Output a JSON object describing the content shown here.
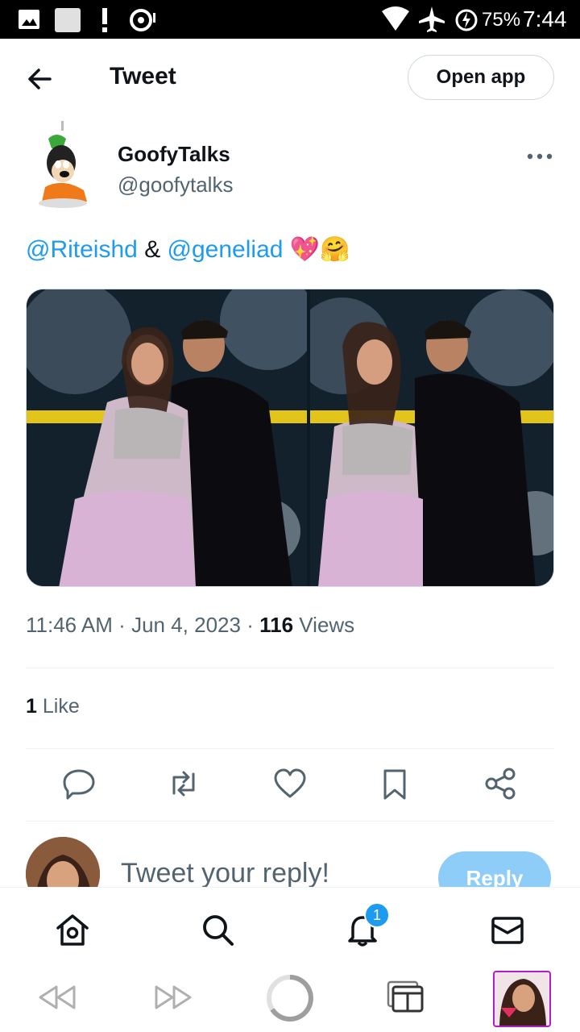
{
  "status_bar": {
    "battery": "75%",
    "time": "7:44"
  },
  "header": {
    "title": "Tweet",
    "open_app_label": "Open app"
  },
  "tweet": {
    "display_name": "GoofyTalks",
    "handle": "@goofytalks",
    "mention1": "@Riteishd",
    "amp": "&",
    "mention2": "@geneliad",
    "emojis": "💖🤗",
    "time": "11:46 AM",
    "date": "Jun 4, 2023",
    "sep": "·",
    "views_count": "116",
    "views_label": "Views",
    "likes_count": "1",
    "likes_label": "Like"
  },
  "reply": {
    "placeholder": "Tweet your reply!",
    "button_label": "Reply"
  },
  "tabbar": {
    "notification_badge": "1"
  },
  "colors": {
    "accent": "#1d9bf0",
    "reply_button": "#8ecdf8",
    "text_secondary": "#536471"
  }
}
